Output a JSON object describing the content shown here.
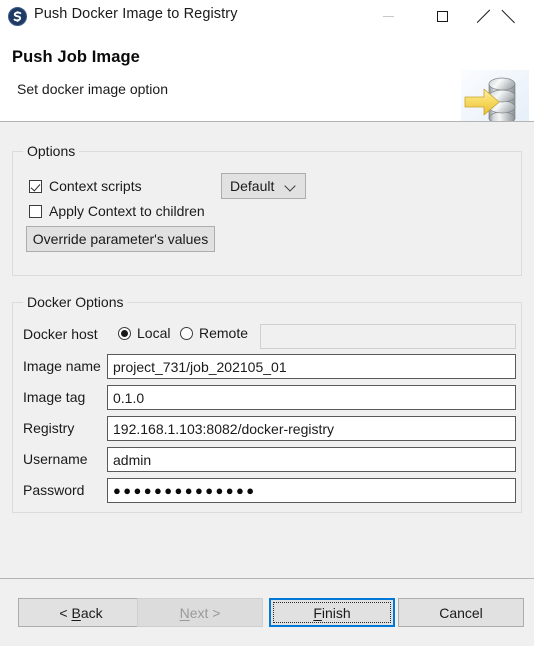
{
  "window": {
    "title": "Push Docker Image to Registry",
    "app_icon": "studio-app-icon",
    "controls": {
      "minimize": "minimize-icon",
      "maximize": "maximize-icon",
      "close": "close-icon"
    }
  },
  "header": {
    "title": "Push Job Image",
    "subtitle": "Set docker image option",
    "banner_icon": "database-push-arrow-icon",
    "banner_colors": {
      "arrow": "#f5d76e",
      "cylinder": "#b8bcbe",
      "background": "#eef4fb"
    }
  },
  "options_group": {
    "legend": "Options",
    "context_scripts": {
      "label": "Context scripts",
      "checked": true
    },
    "context_combo": {
      "value": "Default",
      "options": [
        "Default"
      ]
    },
    "apply_context_children": {
      "label": "Apply Context to children",
      "checked": false
    },
    "override_button": {
      "label": "Override parameter's values"
    }
  },
  "docker_group": {
    "legend": "Docker Options",
    "host": {
      "label": "Docker host",
      "local": {
        "label": "Local",
        "selected": true
      },
      "remote": {
        "label": "Remote",
        "selected": false
      },
      "remote_value": "",
      "remote_enabled": false
    },
    "fields": [
      {
        "label": "Image name",
        "value": "project_731/job_202105_01",
        "type": "text"
      },
      {
        "label": "Image tag",
        "value": "0.1.0",
        "type": "text"
      },
      {
        "label": "Registry",
        "value": "192.168.1.103:8082/docker-registry",
        "type": "text"
      },
      {
        "label": "Username",
        "value": "admin",
        "type": "text"
      },
      {
        "label": "Password",
        "value": "●●●●●●●●●●●●●●",
        "type": "password"
      }
    ]
  },
  "footer": {
    "back": {
      "label": "< Back",
      "accelerator": "B",
      "enabled": true,
      "focused": false
    },
    "next": {
      "label": "Next >",
      "accelerator": "N",
      "enabled": false,
      "focused": false
    },
    "finish": {
      "label": "Finish",
      "accelerator": "F",
      "enabled": true,
      "focused": true
    },
    "cancel": {
      "label": "Cancel",
      "accelerator": "",
      "enabled": true,
      "focused": false
    }
  },
  "colors": {
    "focus_blue": "#0078d7",
    "panel": "#f0f0f0",
    "field_border": "#5a5a5a"
  }
}
